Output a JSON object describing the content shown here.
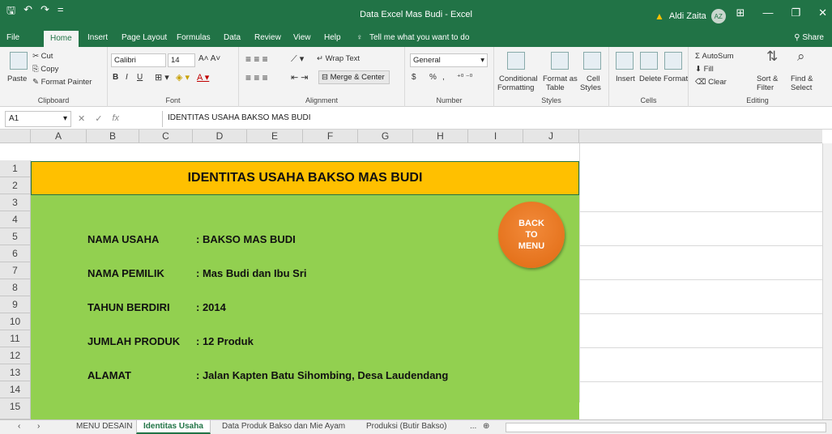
{
  "titlebar": {
    "qat": [
      "🖫",
      "↶",
      "↷",
      "="
    ],
    "title": "Data Excel Mas Budi  -  Excel",
    "user_name": "Aldi Zaita",
    "avatar_initials": "AZ",
    "win_buttons": [
      "⊞",
      "—",
      "❐",
      "✕"
    ]
  },
  "ribbon_tabs": {
    "file": "File",
    "home": "Home",
    "insert": "Insert",
    "page_layout": "Page Layout",
    "formulas": "Formulas",
    "data": "Data",
    "review": "Review",
    "view": "View",
    "help": "Help",
    "tell_me": "Tell me what you want to do",
    "share": "Share"
  },
  "ribbon": {
    "clipboard": {
      "paste": "Paste",
      "cut": "Cut",
      "copy": "Copy",
      "format_painter": "Format Painter",
      "label": "Clipboard"
    },
    "font": {
      "name": "Calibri",
      "size": "14",
      "bold": "B",
      "italic": "I",
      "underline": "U",
      "label": "Font"
    },
    "alignment": {
      "wrap_text": "Wrap Text",
      "merge_center": "Merge & Center",
      "label": "Alignment"
    },
    "number": {
      "format": "General",
      "currency": "$",
      "percent": "%",
      "comma": ",",
      "label": "Number"
    },
    "styles": {
      "conditional": "Conditional",
      "formatting": "Formatting",
      "format_as": "Format as",
      "table": "Table",
      "cell": "Cell",
      "styles_word": "Styles",
      "label": "Styles"
    },
    "cells": {
      "insert": "Insert",
      "delete": "Delete",
      "format": "Format",
      "label": "Cells"
    },
    "editing": {
      "autosum": "AutoSum",
      "fill": "Fill",
      "clear": "Clear",
      "sort": "Sort &",
      "filter": "Filter",
      "find": "Find &",
      "select": "Select",
      "label": "Editing"
    }
  },
  "formula_bar": {
    "cell_ref": "A1",
    "fx": "fx",
    "content": "IDENTITAS USAHA BAKSO MAS BUDI"
  },
  "columns": [
    "A",
    "B",
    "C",
    "D",
    "E",
    "F",
    "G",
    "H",
    "I",
    "J"
  ],
  "rows": [
    "1",
    "2",
    "3",
    "4",
    "5",
    "6",
    "7",
    "8",
    "9",
    "10",
    "11",
    "12",
    "13",
    "14",
    "15"
  ],
  "sheet": {
    "header": "IDENTITAS USAHA BAKSO MAS BUDI",
    "fields": [
      {
        "label": "NAMA USAHA",
        "value": ": BAKSO MAS BUDI"
      },
      {
        "label": "NAMA PEMILIK",
        "value": ": Mas Budi dan Ibu Sri"
      },
      {
        "label": "TAHUN BERDIRI",
        "value": ": 2014"
      },
      {
        "label": "JUMLAH PRODUK",
        "value": ": 12 Produk"
      },
      {
        "label": "ALAMAT",
        "value": ": Jalan Kapten Batu Sihombing, Desa Laudendang"
      }
    ],
    "back_button": {
      "line1": "BACK",
      "line2": "TO",
      "line3": "MENU"
    }
  },
  "sheet_tabs": {
    "menu_desain": "MENU DESAIN",
    "identitas": "Identitas Usaha",
    "data_produk": "Data Produk Bakso dan Mie Ayam",
    "produksi": "Produksi (Butir Bakso)",
    "more": "...",
    "add": "⊕"
  },
  "colors": {
    "excel_green": "#217346",
    "header_fill": "#ffc000",
    "body_fill": "#92d050",
    "button_fill": "#e87722"
  }
}
